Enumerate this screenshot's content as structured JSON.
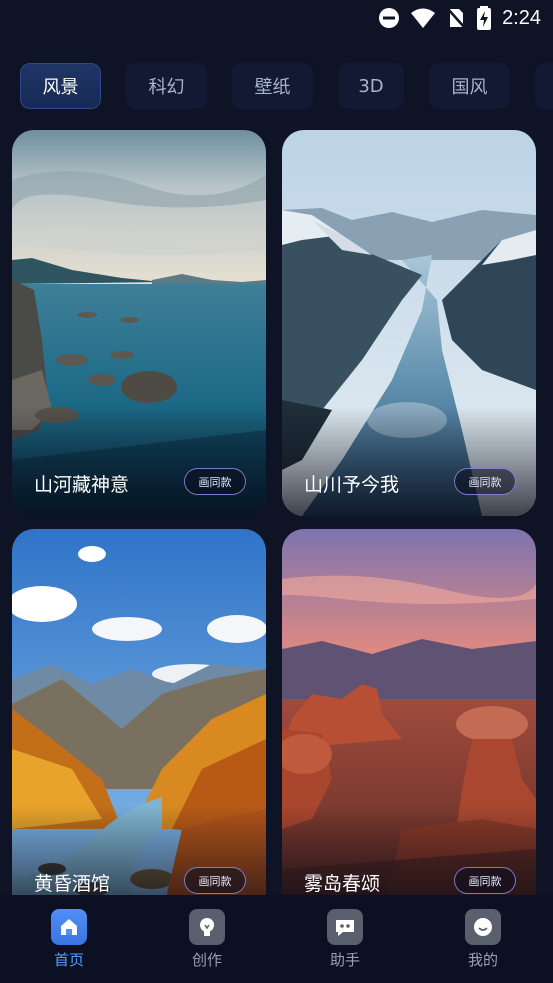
{
  "status_bar": {
    "time": "2:24",
    "icons": [
      "do-not-disturb-icon",
      "wifi-icon",
      "no-sim-icon",
      "battery-charging-icon"
    ]
  },
  "tabs": [
    {
      "label": "风景",
      "active": true
    },
    {
      "label": "科幻",
      "active": false
    },
    {
      "label": "壁纸",
      "active": false
    },
    {
      "label": "3D",
      "active": false
    },
    {
      "label": "国风",
      "active": false
    }
  ],
  "cards": [
    {
      "title": "山河藏神意",
      "button": "画同款",
      "scene": "coastal-sea-rocks"
    },
    {
      "title": "山川予今我",
      "button": "画同款",
      "scene": "fjord-river-mountains"
    },
    {
      "title": "黄昏酒馆",
      "button": "画同款",
      "scene": "autumn-mountain-stream"
    },
    {
      "title": "雾岛春颂",
      "button": "画同款",
      "scene": "red-rock-desert-sunset"
    }
  ],
  "bottom_nav": [
    {
      "label": "首页",
      "icon": "home-icon",
      "active": true
    },
    {
      "label": "创作",
      "icon": "bulb-icon",
      "active": false
    },
    {
      "label": "助手",
      "icon": "chat-icon",
      "active": false
    },
    {
      "label": "我的",
      "icon": "face-icon",
      "active": false
    }
  ],
  "colors": {
    "background": "#0e1326",
    "accent": "#5e9bff",
    "tab_active": "#1f3566",
    "nav_background": "#0b1022"
  }
}
